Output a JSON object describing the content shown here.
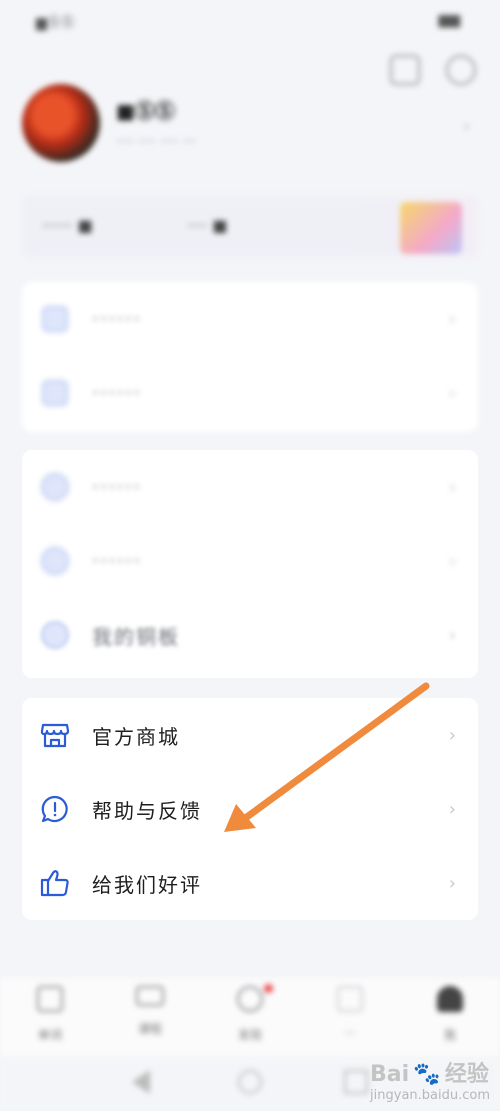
{
  "status": {
    "left": "▆ⓈⓈ",
    "right": "▆▆"
  },
  "profile": {
    "username": "■ⓈⓈ",
    "sub": "···· ···· ···· ···"
  },
  "banner": {
    "item1": "······ ■",
    "item2": "···· ■"
  },
  "group1": [
    {
      "label": "······",
      "icon": "book-icon"
    },
    {
      "label": "······",
      "icon": "notebook-icon"
    }
  ],
  "group2": [
    {
      "label": "······",
      "icon": "star-icon"
    },
    {
      "label": "······",
      "icon": "download-icon"
    },
    {
      "label": "我的铜板",
      "icon": "coin-icon"
    }
  ],
  "group3": [
    {
      "label": "官方商城",
      "icon": "store-icon"
    },
    {
      "label": "帮助与反馈",
      "icon": "help-chat-icon"
    },
    {
      "label": "给我们好评",
      "icon": "thumbs-up-icon"
    }
  ],
  "bottom_nav": [
    {
      "label": "单词",
      "icon": "word-icon"
    },
    {
      "label": "课程",
      "icon": "video-icon"
    },
    {
      "label": "发现",
      "icon": "compass-icon"
    },
    {
      "label": "···",
      "icon": "book-icon"
    },
    {
      "label": "我",
      "icon": "person-icon"
    }
  ],
  "colors": {
    "accent": "#2b5bd7",
    "arrow": "#f08a3c",
    "badge": "#e8484c"
  },
  "watermark": {
    "brand": "Bai",
    "suffix": "经验",
    "url": "jingyan.baidu.com"
  }
}
